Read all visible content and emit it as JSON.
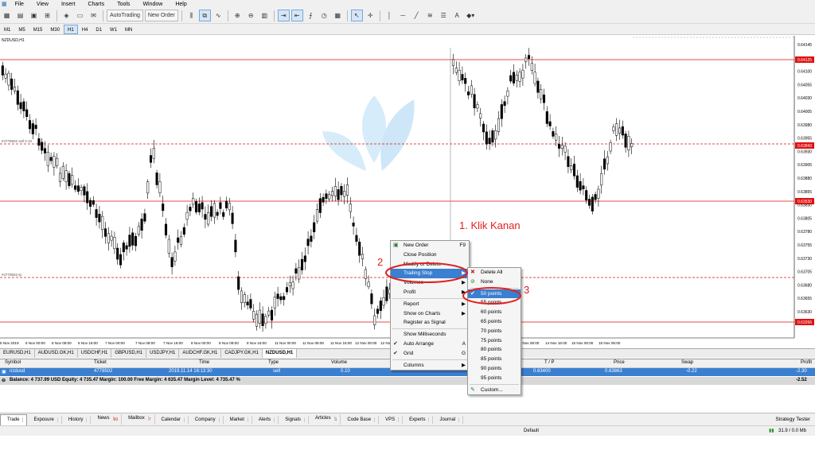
{
  "menubar": {
    "items": [
      "File",
      "View",
      "Insert",
      "Charts",
      "Tools",
      "Window",
      "Help"
    ]
  },
  "toolbar": {
    "autotrading": "AutoTrading",
    "new_order": "New Order"
  },
  "timeframes": [
    "M1",
    "M5",
    "M15",
    "M30",
    "H1",
    "H4",
    "D1",
    "W1",
    "MN"
  ],
  "active_timeframe": "H1",
  "chart": {
    "title": "NZDUSD,H1",
    "price_labels": [
      "0.64145",
      "0.64125",
      "0.64100",
      "0.64055",
      "0.64030",
      "0.64005",
      "0.63980",
      "0.63955",
      "0.63930",
      "0.63905",
      "0.63880",
      "0.63855",
      "0.63830",
      "0.63805",
      "0.63780",
      "0.63755",
      "0.63730",
      "0.63705",
      "0.63680",
      "0.63655",
      "0.63630"
    ],
    "marked_prices": [
      {
        "price": "0.64125",
        "color": "#e01010"
      },
      {
        "price": "0.63843",
        "color": "#e01010"
      },
      {
        "price": "0.63530",
        "color": "#e01010"
      },
      {
        "price": "0.63266",
        "color": "#e01010"
      }
    ],
    "order_label_1": "#4779502 sell 0.10",
    "order_label_2": "#4779502 tp",
    "time_labels": [
      "5 Nov 2019",
      "6 Nov 00:00",
      "6 Nov 08:00",
      "6 Nov 16:00",
      "7 Nov 00:00",
      "7 Nov 08:00",
      "7 Nov 16:00",
      "8 Nov 00:00",
      "8 Nov 08:00",
      "8 Nov 16:00",
      "11 Nov 00:00",
      "11 Nov 08:00",
      "11 Nov 16:00",
      "12 Nov 00:00",
      "12 Nov 08:00",
      "14 Nov 08:00",
      "14 Nov 16:00",
      "15 Nov 00:00",
      "15 Nov 08:00"
    ]
  },
  "chart_tabs": [
    "EURUSD,H1",
    "AUDUSD.GK,H1",
    "USDCHF,H1",
    "GBPUSD,H1",
    "USDJPY,H1",
    "AUDCHF.GK,H1",
    "CADJPY.GK,H1",
    "NZDUSD,H1"
  ],
  "active_chart_tab": "NZDUSD,H1",
  "terminal": {
    "headers": {
      "symbol": "Symbol",
      "ticket": "Ticket",
      "time": "Time",
      "type": "Type",
      "volume": "Volume",
      "tp": "T / P",
      "price": "Price",
      "swap": "Swap",
      "profit": "Profit"
    },
    "row": {
      "symbol": "nzdusd",
      "ticket": "4779502",
      "time": "2019.11.14 16:13:30",
      "type": "sell",
      "volume": "0.10",
      "tp": "0.63400",
      "price": "0.63863",
      "swap": "-0.22",
      "profit": "-2.30"
    },
    "balance_text": "Balance: 4 737.99 USD  Equity: 4 735.47  Margin: 100.00  Free Margin: 4 635.47  Margin Level: 4 735.47 %",
    "balance_profit": "-2.52"
  },
  "bottom_tabs": [
    {
      "label": "Trade",
      "badge": ""
    },
    {
      "label": "Exposure",
      "badge": ""
    },
    {
      "label": "History",
      "badge": ""
    },
    {
      "label": "News",
      "badge": "99"
    },
    {
      "label": "Mailbox",
      "badge": "7"
    },
    {
      "label": "Calendar",
      "badge": ""
    },
    {
      "label": "Company",
      "badge": ""
    },
    {
      "label": "Market",
      "badge": ""
    },
    {
      "label": "Alerts",
      "badge": ""
    },
    {
      "label": "Signals",
      "badge": ""
    },
    {
      "label": "Articles",
      "badge": "1"
    },
    {
      "label": "Code Base",
      "badge": ""
    },
    {
      "label": "VPS",
      "badge": ""
    },
    {
      "label": "Experts",
      "badge": ""
    },
    {
      "label": "Journal",
      "badge": ""
    }
  ],
  "strategy_tester": "Strategy Tester",
  "status": {
    "profile": "Default",
    "traffic": "31.9 / 0.0 Mb"
  },
  "context_menu": {
    "items": [
      {
        "label": "New Order",
        "key": "F9",
        "icon": "new-order-icon"
      },
      {
        "label": "Close Position",
        "key": ""
      },
      {
        "label": "Modify or Delete",
        "key": ""
      },
      {
        "label": "Trailing Stop",
        "key": "▶",
        "hl": true
      },
      {
        "label": "Volumes",
        "key": "▶"
      },
      {
        "label": "Profit",
        "key": "▶"
      },
      {
        "sep": true
      },
      {
        "label": "Report",
        "key": "▶"
      },
      {
        "label": "Show on Charts",
        "key": "▶"
      },
      {
        "label": "Register as Signal",
        "key": ""
      },
      {
        "sep": true
      },
      {
        "label": "Show Milliseconds",
        "key": ""
      },
      {
        "label": "Auto Arrange",
        "key": "A",
        "check": true
      },
      {
        "label": "Grid",
        "key": "G",
        "check": true
      },
      {
        "sep": true
      },
      {
        "label": "Columns",
        "key": "▶"
      }
    ]
  },
  "submenu": {
    "items": [
      {
        "label": "Delete All",
        "icon": "delete-icon"
      },
      {
        "label": "None",
        "icon": "none-icon"
      },
      {
        "sep": true
      },
      {
        "label": "50 points",
        "check": true,
        "hl": true
      },
      {
        "label": "55 points"
      },
      {
        "label": "60 points"
      },
      {
        "label": "65 points"
      },
      {
        "label": "70 points"
      },
      {
        "label": "75 points"
      },
      {
        "label": "80 points"
      },
      {
        "label": "85 points"
      },
      {
        "label": "90 points"
      },
      {
        "label": "95 points"
      },
      {
        "sep": true
      },
      {
        "label": "Custom...",
        "icon": "custom-icon"
      }
    ]
  },
  "annotations": {
    "step1": "1. Klik Kanan",
    "step2": "2",
    "step3": "3",
    "color": "#e02020"
  }
}
